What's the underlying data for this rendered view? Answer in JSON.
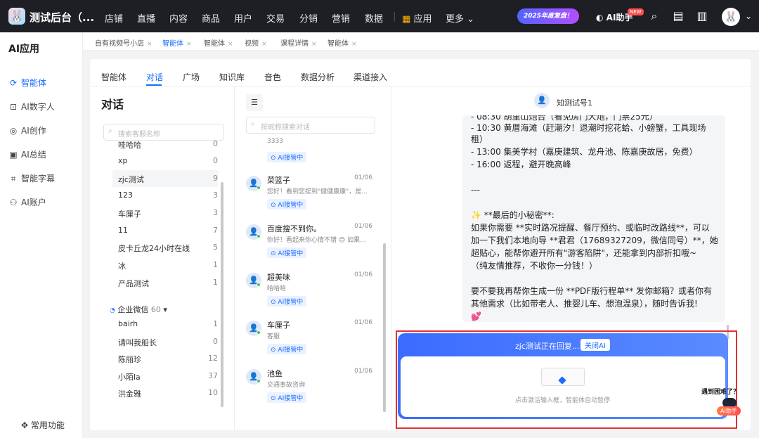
{
  "app": {
    "title": "测试后台（...",
    "logo_icon": "bunny-logo"
  },
  "topnav": [
    "店铺",
    "直播",
    "内容",
    "商品",
    "用户",
    "交易",
    "分销",
    "营销",
    "数据"
  ],
  "topnav_apps": "应用",
  "topnav_more": "更多",
  "promo_text": "2025年度复盘！",
  "ai_helper": {
    "label": "AI助手",
    "badge": "NEW"
  },
  "sidebar": {
    "title": "AI应用",
    "items": [
      {
        "label": "智能体",
        "icon": "agent-icon",
        "active": true
      },
      {
        "label": "AI数字人",
        "icon": "robot-icon"
      },
      {
        "label": "AI创作",
        "icon": "lightbulb-icon"
      },
      {
        "label": "AI总结",
        "icon": "document-icon"
      },
      {
        "label": "智能字幕",
        "icon": "caption-icon"
      },
      {
        "label": "AI账户",
        "icon": "account-icon"
      }
    ],
    "footer": "常用功能"
  },
  "crumbs": [
    {
      "label": "自有视频号小店"
    },
    {
      "label": "智能体",
      "active": true
    },
    {
      "label": "智能体"
    },
    {
      "label": "视频"
    },
    {
      "label": "课程详情"
    },
    {
      "label": "智能体"
    }
  ],
  "main_tabs": [
    {
      "label": "智能体"
    },
    {
      "label": "对话",
      "active": true
    },
    {
      "label": "广场"
    },
    {
      "label": "知识库"
    },
    {
      "label": "音色"
    },
    {
      "label": "数据分析"
    },
    {
      "label": "渠道接入"
    }
  ],
  "column1": {
    "title": "对话",
    "search_placeholder": "搜索客服名称",
    "rows": [
      {
        "name": "哇哈哈",
        "count": "0"
      },
      {
        "name": "xp",
        "count": "0"
      },
      {
        "name": "zjc测试",
        "count": "9",
        "selected": true
      },
      {
        "name": "123",
        "count": "3"
      },
      {
        "name": "车厘子",
        "count": "3"
      },
      {
        "name": "11",
        "count": "7"
      },
      {
        "name": "皮卡丘龙24小时在线",
        "count": "5"
      },
      {
        "name": "冰",
        "count": "1"
      },
      {
        "name": "产品测试",
        "count": "1"
      }
    ],
    "group": {
      "label": "企业微信",
      "count": "60"
    },
    "group_rows": [
      {
        "name": "bairh",
        "count": "1"
      },
      {
        "name": "请叫我船长",
        "count": "0"
      },
      {
        "name": "陈丽珍",
        "count": "12"
      },
      {
        "name": "小陌la",
        "count": "37"
      },
      {
        "name": "洪金雅",
        "count": "10"
      }
    ]
  },
  "column2": {
    "search_placeholder": "按昵称搜索对话",
    "partial": {
      "preview": "3333",
      "tag": "AI接管中"
    },
    "conversations": [
      {
        "name": "菜篮子",
        "date": "01/06",
        "preview": "您好！看到您提到\"健健康康\"，是...",
        "tag": "AI接管中"
      },
      {
        "name": "百度搜不到你。",
        "date": "01/06",
        "preview": "你好！看起来你心情不错 😊 如果...",
        "tag": "AI接管中"
      },
      {
        "name": "超美味",
        "date": "01/06",
        "preview": "哈哈哈",
        "tag": "AI接管中"
      },
      {
        "name": "车厘子",
        "date": "01/06",
        "preview": "客服",
        "tag": "AI接管中"
      },
      {
        "name": "池鱼",
        "date": "01/06",
        "preview": "交通事故咨询",
        "tag": "AI接管中"
      }
    ]
  },
  "chat": {
    "contact": "知测试号1",
    "lines": [
      "- 08:30 胡里山炮台（看免房门大炮，门票25元）",
      "- 10:30 黄厝海滩（赶潮汐！退潮时挖花蛤、小螃蟹，工具现场",
      "租）",
      "- 13:00 集美学村（嘉庚建筑、龙舟池、陈嘉庚故居，免费）",
      "- 16:00 返程，避开晚高峰",
      "",
      "---",
      "",
      "✨ **最后的小秘密**:",
      "如果你需要 **实时路况提醒、餐厅预约、或临时改路线**，可以",
      "加一下我们本地向导 **君君（17689327209，微信同号）**，她",
      "超贴心，能帮你避开所有\"游客陷阱\"，还能拿到内部折扣哦~",
      "（纯友情推荐，不收你一分钱！）",
      "",
      "要不要我再帮你生成一份 **PDF版行程单** 发你邮箱？或者你有",
      "其他需求（比如带老人、推婴儿车、想泡温泉），随时告诉我!",
      "💕"
    ]
  },
  "takeover": {
    "status": "zjc测试正在回复...",
    "close_button": "关闭AI",
    "hint": "点击激活输入框，智能体自动暂停",
    "help": "遇到困难了？",
    "ai_badge": "AI助手"
  }
}
